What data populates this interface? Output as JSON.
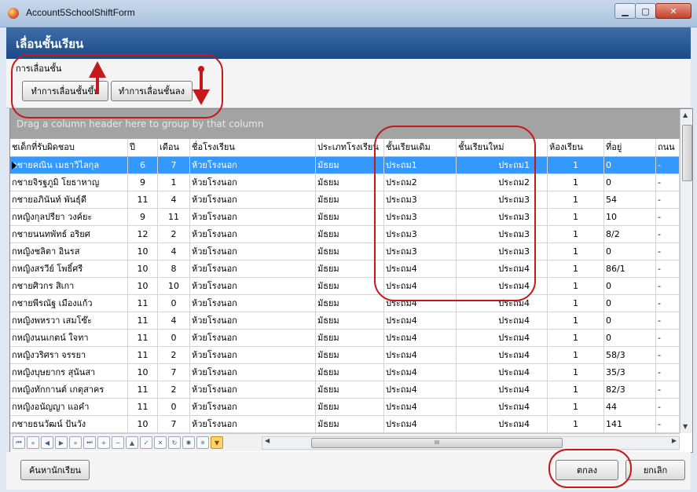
{
  "window": {
    "title": "Account5SchoolShiftForm",
    "icon": "app-icon",
    "controls": [
      "minimize-icon",
      "maximize-icon",
      "close-icon"
    ]
  },
  "header": {
    "title": "เลื่อนชั้นเรียน"
  },
  "group": {
    "label": "การเลื่อนชั้น",
    "promote_label": "ทำการเลื่อนชั้นขึ้น",
    "demote_label": "ทำการเลื่อนชั้นลง"
  },
  "grid": {
    "group_panel_text": "Drag a column header here to group by that column",
    "columns": [
      "ชเด็กที่รับผิดชอบ",
      "ปี",
      "เดือน",
      "ชื่อโรงเรียน",
      "ประเภทโรงเรียน",
      "ชั้นเรียนเดิม",
      "ชั้นเรียนใหม่",
      "ห้องเรียน",
      "ที่อยู่",
      "ถนน"
    ],
    "rows": [
      [
        "กชายคณิน เมธาวิไลกุล",
        "6",
        "7",
        "ห้วยโรงนอก",
        "มัธยม",
        "ประถม1",
        "ประถม1",
        "1",
        "0",
        "-"
      ],
      [
        "กชายจิรฐภูมิ โยธาหาญ",
        "9",
        "1",
        "ห้วยโรงนอก",
        "มัธยม",
        "ประถม2",
        "ประถม2",
        "1",
        "0",
        "-"
      ],
      [
        "กชายอภินันท์ พันธุ์ดี",
        "11",
        "4",
        "ห้วยโรงนอก",
        "มัธยม",
        "ประถม3",
        "ประถม3",
        "1",
        "54",
        "-"
      ],
      [
        "กหญิงกุลปรียา วงค์ยะ",
        "9",
        "11",
        "ห้วยโรงนอก",
        "มัธยม",
        "ประถม3",
        "ประถม3",
        "1",
        "10",
        "-"
      ],
      [
        "กชายนนทพัทธ์ อริยศ",
        "12",
        "2",
        "ห้วยโรงนอก",
        "มัธยม",
        "ประถม3",
        "ประถม3",
        "1",
        "8/2",
        "-"
      ],
      [
        "กหญิงชลิตา อินรส",
        "10",
        "4",
        "ห้วยโรงนอก",
        "มัธยม",
        "ประถม3",
        "ประถม3",
        "1",
        "0",
        "-"
      ],
      [
        "กหญิงสรวีย์ โพธิ์ศรี",
        "10",
        "8",
        "ห้วยโรงนอก",
        "มัธยม",
        "ประถม4",
        "ประถม4",
        "1",
        "86/1",
        "-"
      ],
      [
        "กชายศิวกร สิเกา",
        "10",
        "10",
        "ห้วยโรงนอก",
        "มัธยม",
        "ประถม4",
        "ประถม4",
        "1",
        "0",
        "-"
      ],
      [
        "กชายพีรณัฐ เมืองแก้ว",
        "11",
        "0",
        "ห้วยโรงนอก",
        "มัธยม",
        "ประถม4",
        "ประถม4",
        "1",
        "0",
        "-"
      ],
      [
        "กหญิงพหรวา เสมโซ๊ะ",
        "11",
        "4",
        "ห้วยโรงนอก",
        "มัธยม",
        "ประถม4",
        "ประถม4",
        "1",
        "0",
        "-"
      ],
      [
        "กหญิงนนเกตน์ ใจทา",
        "11",
        "0",
        "ห้วยโรงนอก",
        "มัธยม",
        "ประถม4",
        "ประถม4",
        "1",
        "0",
        "-"
      ],
      [
        "กหญิงวริศรา จรรยา",
        "11",
        "2",
        "ห้วยโรงนอก",
        "มัธยม",
        "ประถม4",
        "ประถม4",
        "1",
        "58/3",
        "-"
      ],
      [
        "กหญิงบุษยากร สุนันสา",
        "10",
        "7",
        "ห้วยโรงนอก",
        "มัธยม",
        "ประถม4",
        "ประถม4",
        "1",
        "35/3",
        "-"
      ],
      [
        "กหญิงทักกานต์ เกตุสาคร",
        "11",
        "2",
        "ห้วยโรงนอก",
        "มัธยม",
        "ประถม4",
        "ประถม4",
        "1",
        "82/3",
        "-"
      ],
      [
        "กหญิงอนัญญา แอคำ",
        "11",
        "0",
        "ห้วยโรงนอก",
        "มัธยม",
        "ประถม4",
        "ประถม4",
        "1",
        "44",
        "-"
      ],
      [
        "กชายธนวัฒน์ ปันวัง",
        "10",
        "7",
        "ห้วยโรงนอก",
        "มัธยม",
        "ประถม4",
        "ประถม4",
        "1",
        "141",
        "-"
      ]
    ],
    "selected_row": 0,
    "navigator_buttons": [
      "first",
      "prev-page",
      "prev",
      "next",
      "next-page",
      "last",
      "append",
      "remove",
      "up",
      "apply",
      "cancel",
      "refresh",
      "star",
      "sparkle",
      "filter"
    ],
    "hscroll_grip": "III"
  },
  "footer": {
    "search_label": "ค้นหานักเรียน",
    "ok_label": "ตกลง",
    "cancel_label": "ยกเลิก"
  },
  "annotation_color": "#c4181b",
  "selection_color": "#3399ff"
}
